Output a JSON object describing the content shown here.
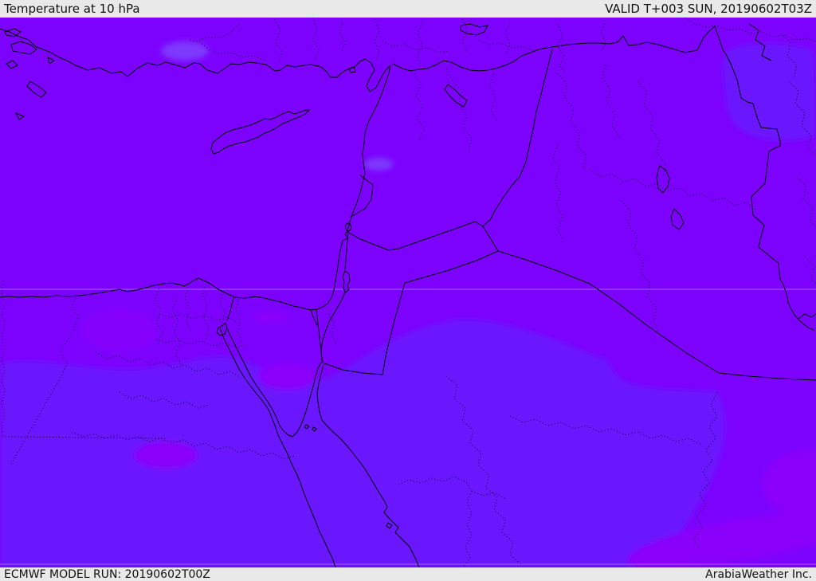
{
  "header": {
    "title": "Temperature at 10 hPa",
    "valid_label": "VALID T+003 SUN, 20190602T03Z"
  },
  "footer": {
    "model_run": "ECMWF MODEL RUN: 20190602T00Z",
    "credit": "ArabiaWeather Inc."
  },
  "map": {
    "kind": "forecast-temperature-field",
    "field_title": "Temperature at 10 hPa",
    "valid_time": "20190602T03Z",
    "lead_time": "T+003",
    "model_run_time": "20190602T00Z",
    "colors": {
      "field_main": "#7c02fe",
      "field_cool": "#6b17fe",
      "field_cooler": "#7e38fe",
      "field_warm": "#8a06fa",
      "line": "#000000",
      "grid": "#c3b2f8",
      "bar_bg": "#e9e9e9",
      "bar_text": "#111111"
    }
  }
}
